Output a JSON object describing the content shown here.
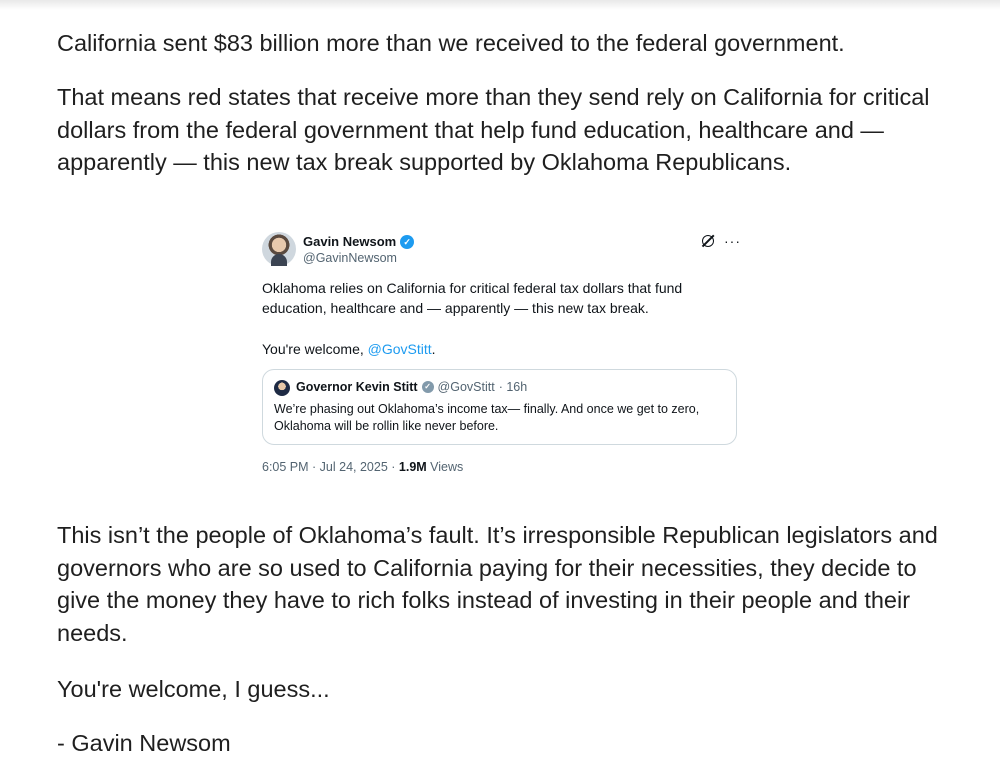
{
  "post": {
    "p1": "California sent $83 billion more than we received to the federal government.",
    "p2": "That means red states that receive more than they send rely on California for critical dollars from the federal government that help fund education, healthcare and — apparently — this new tax break supported by Oklahoma Republicans.",
    "p3": "This isn’t the people of Oklahoma’s fault. It’s irresponsible Republican legislators and governors who are so used to California paying for their necessities, they decide to give the money they have to rich folks instead of investing in their people and their needs.",
    "p4": "You're welcome, I guess...",
    "p5": "- Gavin Newsom"
  },
  "tweet": {
    "author_name": "Gavin Newsom",
    "author_handle": "@GavinNewsom",
    "verified_mark": "✓",
    "body": "Oklahoma relies on California for critical federal tax dollars that fund education, healthcare and — apparently — this new tax break.",
    "welcome_prefix": "You're welcome, ",
    "welcome_mention": "@GovStitt",
    "welcome_suffix": ".",
    "more_label": "···",
    "timestamp": "6:05 PM · Jul 24, 2025 · ",
    "views_count": "1.9M",
    "views_label": " Views",
    "quote": {
      "author_name": "Governor Kevin Stitt",
      "author_handle": "@GovStitt",
      "age": "· 16h",
      "check_mark": "✓",
      "text": "We’re phasing out Oklahoma’s income tax— finally. And once we get to zero, Oklahoma will be rollin like never before."
    }
  },
  "colors": {
    "link": "#1d9bf0",
    "verified_blue": "#1d9bf0",
    "verified_gray": "#829aab",
    "meta_gray": "#536471"
  },
  "icons": [
    "grok-icon",
    "more-icon",
    "verified-badge-icon",
    "gray-verified-badge-icon"
  ]
}
